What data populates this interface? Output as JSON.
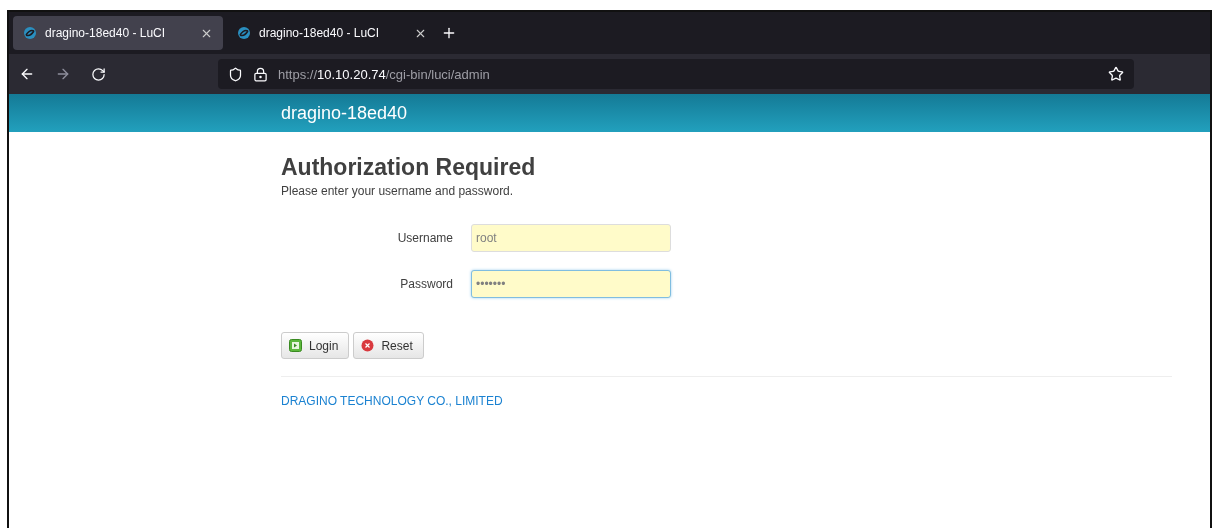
{
  "browser": {
    "tabs": [
      {
        "title": "dragino-18ed40 - LuCI",
        "selected": true
      },
      {
        "title": "dragino-18ed40 - LuCI",
        "selected": false
      }
    ],
    "address": {
      "scheme": "https://",
      "host": "10.10.20.74",
      "path": "/cgi-bin/luci/admin"
    }
  },
  "header": {
    "hostname": "dragino-18ed40"
  },
  "login": {
    "title": "Authorization Required",
    "subtitle": "Please enter your username and password.",
    "fields": [
      {
        "label": "Username",
        "value": "root",
        "focused": false
      },
      {
        "label": "Password",
        "value": "•••••••",
        "focused": true
      }
    ],
    "buttons": [
      {
        "kind": "login",
        "label": "Login"
      },
      {
        "kind": "reset",
        "label": "Reset"
      }
    ]
  },
  "footer": {
    "link": "DRAGINO TECHNOLOGY CO., LIMITED"
  }
}
